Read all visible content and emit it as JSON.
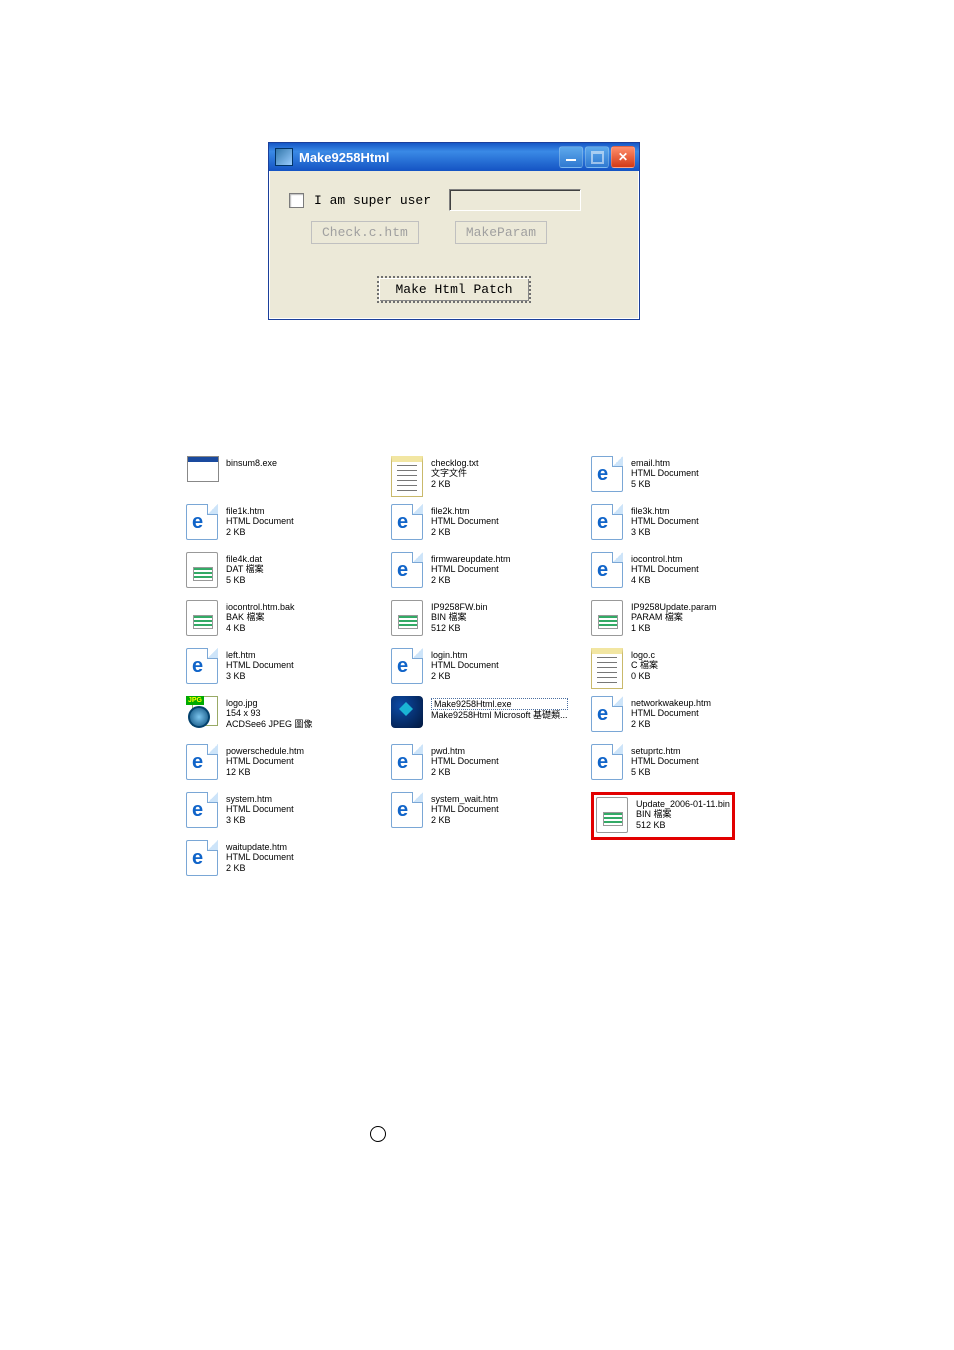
{
  "dialog": {
    "title": "Make9258Html",
    "checkbox_label": "I am super user",
    "btn_check": "Check.c.htm",
    "btn_makeparam": "MakeParam",
    "btn_makepatch": "Make Html Patch"
  },
  "columns": [
    [
      {
        "icon": "exe",
        "name": "binsum8.exe",
        "line2": "",
        "line3": ""
      },
      {
        "icon": "ie",
        "name": "file1k.htm",
        "line2": "HTML Document",
        "line3": "2 KB"
      },
      {
        "icon": "dat",
        "name": "file4k.dat",
        "line2": "DAT 檔案",
        "line3": "5 KB"
      },
      {
        "icon": "dat",
        "name": "iocontrol.htm.bak",
        "line2": "BAK 檔案",
        "line3": "4 KB"
      },
      {
        "icon": "ie",
        "name": "left.htm",
        "line2": "HTML Document",
        "line3": "3 KB"
      },
      {
        "icon": "jpg",
        "name": "logo.jpg",
        "line2": "154 x 93",
        "line3": "ACDSee6 JPEG 圖像"
      },
      {
        "icon": "ie",
        "name": "powerschedule.htm",
        "line2": "HTML Document",
        "line3": "12 KB"
      },
      {
        "icon": "ie",
        "name": "system.htm",
        "line2": "HTML Document",
        "line3": "3 KB"
      },
      {
        "icon": "ie",
        "name": "waitupdate.htm",
        "line2": "HTML Document",
        "line3": "2 KB"
      }
    ],
    [
      {
        "icon": "txt",
        "name": "checklog.txt",
        "line2": "文字文件",
        "line3": "2 KB"
      },
      {
        "icon": "ie",
        "name": "file2k.htm",
        "line2": "HTML Document",
        "line3": "2 KB"
      },
      {
        "icon": "ie",
        "name": "firmwareupdate.htm",
        "line2": "HTML Document",
        "line3": "2 KB"
      },
      {
        "icon": "bin",
        "name": "IP9258FW.bin",
        "line2": "BIN 檔案",
        "line3": "512 KB"
      },
      {
        "icon": "ie",
        "name": "login.htm",
        "line2": "HTML Document",
        "line3": "2 KB"
      },
      {
        "icon": "mfc",
        "name": "Make9258Html.exe",
        "line2": "Make9258Html Microsoft 基礎類...",
        "line3": "",
        "selected": true
      },
      {
        "icon": "ie",
        "name": "pwd.htm",
        "line2": "HTML Document",
        "line3": "2 KB"
      },
      {
        "icon": "ie",
        "name": "system_wait.htm",
        "line2": "HTML Document",
        "line3": "2 KB"
      }
    ],
    [
      {
        "icon": "ie",
        "name": "email.htm",
        "line2": "HTML Document",
        "line3": "5 KB"
      },
      {
        "icon": "ie",
        "name": "file3k.htm",
        "line2": "HTML Document",
        "line3": "3 KB"
      },
      {
        "icon": "ie",
        "name": "iocontrol.htm",
        "line2": "HTML Document",
        "line3": "4 KB"
      },
      {
        "icon": "param",
        "name": "IP9258Update.param",
        "line2": "PARAM 檔案",
        "line3": "1 KB"
      },
      {
        "icon": "txt",
        "name": "logo.c",
        "line2": "C 檔案",
        "line3": "0 KB"
      },
      {
        "icon": "ie",
        "name": "networkwakeup.htm",
        "line2": "HTML Document",
        "line3": "2 KB"
      },
      {
        "icon": "ie",
        "name": "setuprtc.htm",
        "line2": "HTML Document",
        "line3": "5 KB"
      },
      {
        "icon": "bin",
        "name": "Update_2006-01-11.bin",
        "line2": "BIN 檔案",
        "line3": "512 KB",
        "highlight": true
      }
    ]
  ]
}
